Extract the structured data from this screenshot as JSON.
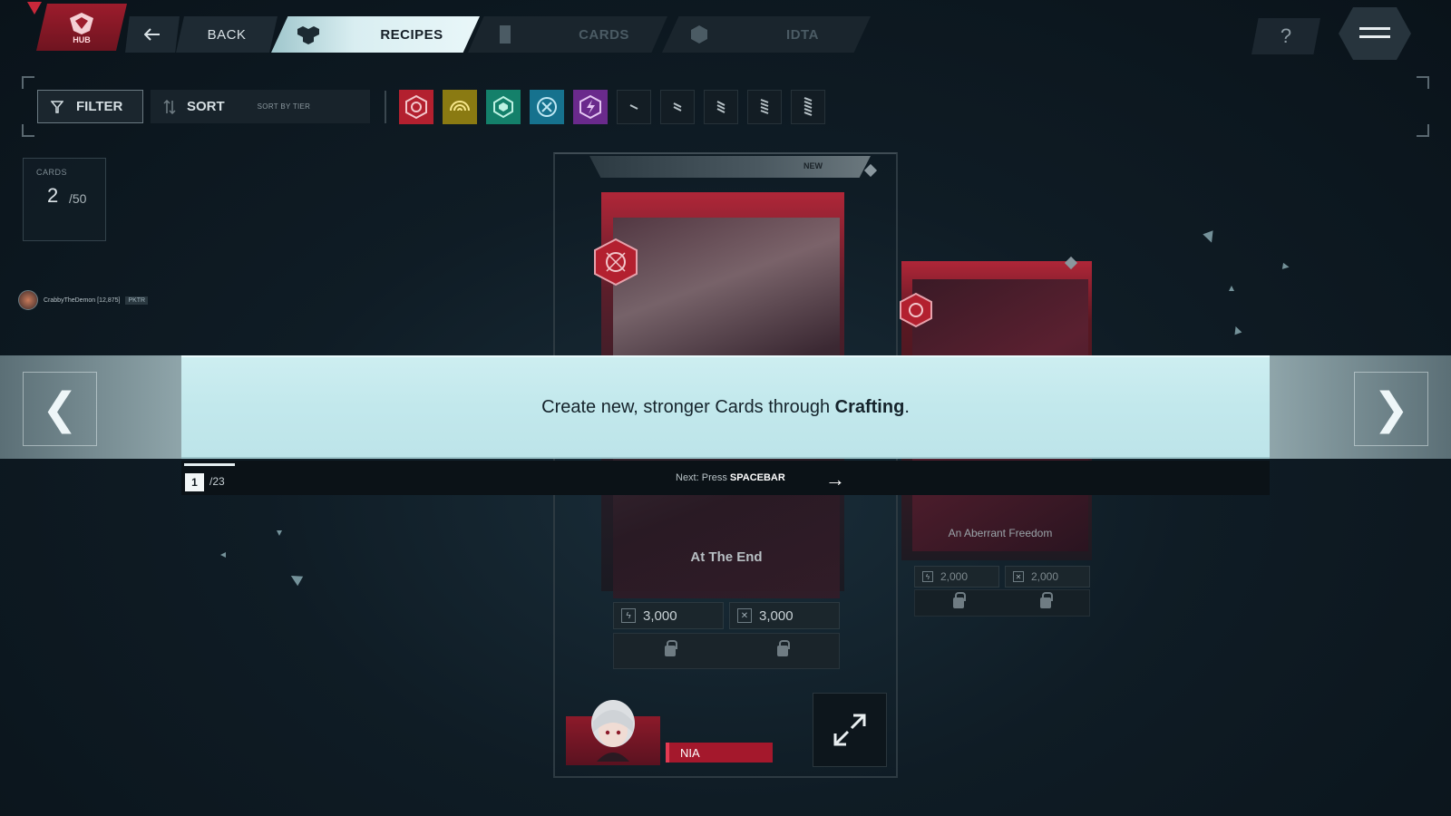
{
  "nav": {
    "hub_label": "HUB",
    "back_label": "BACK",
    "tabs": [
      {
        "label": "RECIPES",
        "active": true
      },
      {
        "label": "CARDS",
        "active": false
      },
      {
        "label": "IDTA",
        "active": false
      }
    ],
    "help_label": "?"
  },
  "filter_bar": {
    "filter_label": "FILTER",
    "sort_label": "SORT",
    "sort_value": "SORT BY TIER",
    "type_icons": [
      "crimson-sigil-icon",
      "yellow-wave-icon",
      "green-hex-icon",
      "blue-cross-icon",
      "purple-bolt-icon"
    ],
    "tier_icons": [
      "tier-1-icon",
      "tier-2-icon",
      "tier-3-icon",
      "tier-4-icon",
      "tier-5-icon"
    ]
  },
  "collection": {
    "label": "CARDS",
    "count": "2",
    "max": "/50"
  },
  "user": {
    "name": "CrabbyTheDemon [12,875]",
    "tag": "PKTR"
  },
  "cards": [
    {
      "name": "At The End",
      "badge": "NEW",
      "cost_a": "3,000",
      "cost_b": "3,000"
    },
    {
      "name": "An Aberrant Freedom",
      "cost_a": "2,000",
      "cost_b": "2,000"
    }
  ],
  "tutorial": {
    "text_before": "Create new, stronger Cards through ",
    "text_bold": "Crafting",
    "text_after": ".",
    "page": "1",
    "total": "/23",
    "next_prefix": "Next: Press ",
    "next_key": "SPACEBAR",
    "prev_glyph": "❮",
    "next_glyph": "❯"
  },
  "character": {
    "name": "NIA"
  },
  "colors": {
    "accent_red": "#a4182c",
    "banner_cyan": "#c2e8ec",
    "bg_dark": "#0f1c25"
  }
}
